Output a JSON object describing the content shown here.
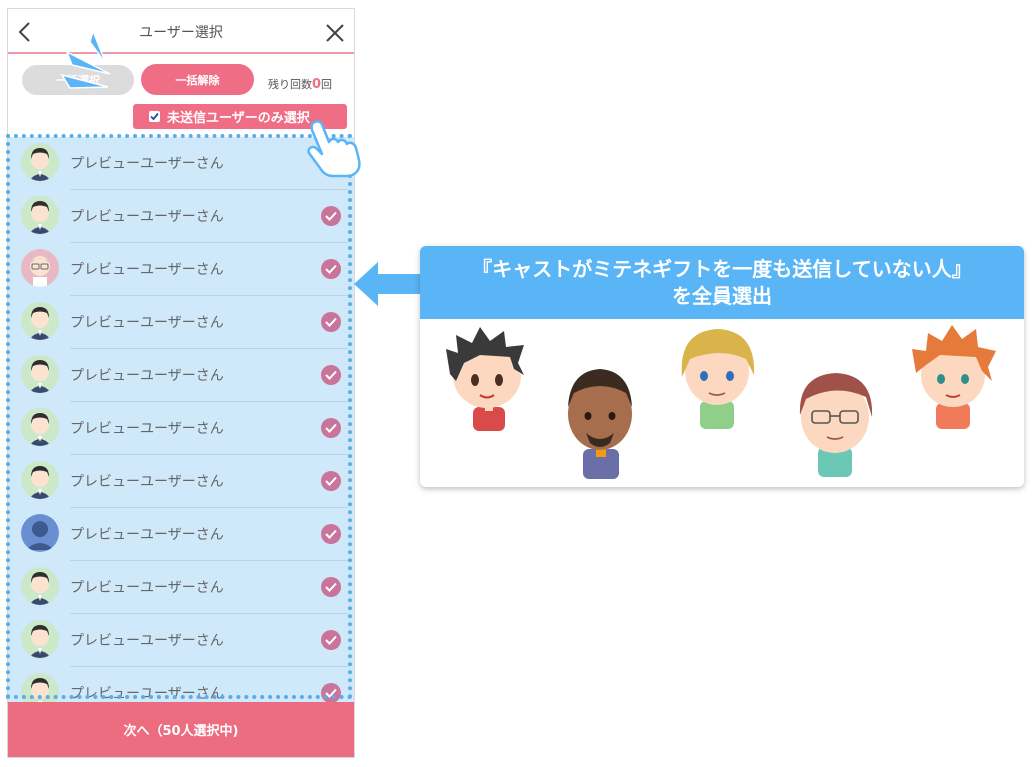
{
  "header": {
    "title": "ユーザー選択",
    "back_icon": "chevron-left-icon",
    "close_icon": "close-icon"
  },
  "toolbar": {
    "select_all_label": "一括選択",
    "deselect_all_label": "一括解除",
    "remaining_prefix": "残り回数",
    "remaining_count": "0",
    "remaining_suffix": "回",
    "unsent_only_label": "未送信ユーザーのみ選択",
    "unsent_only_checked": true
  },
  "users": [
    {
      "name": "プレビューユーザーさん",
      "avatar": "avatar-dark-hair",
      "selected": false
    },
    {
      "name": "プレビューユーザーさん",
      "avatar": "avatar-dark-hair",
      "selected": true
    },
    {
      "name": "プレビューユーザーさん",
      "avatar": "avatar-glasses",
      "selected": true
    },
    {
      "name": "プレビューユーザーさん",
      "avatar": "avatar-dark-hair",
      "selected": true
    },
    {
      "name": "プレビューユーザーさん",
      "avatar": "avatar-dark-hair",
      "selected": true
    },
    {
      "name": "プレビューユーザーさん",
      "avatar": "avatar-dark-hair",
      "selected": true
    },
    {
      "name": "プレビューユーザーさん",
      "avatar": "avatar-dark-hair",
      "selected": true
    },
    {
      "name": "プレビューユーザーさん",
      "avatar": "avatar-silhouette",
      "selected": true
    },
    {
      "name": "プレビューユーザーさん",
      "avatar": "avatar-dark-hair",
      "selected": true
    },
    {
      "name": "プレビューユーザーさん",
      "avatar": "avatar-dark-hair",
      "selected": true
    },
    {
      "name": "プレビューユーザーさん",
      "avatar": "avatar-dark-hair",
      "selected": true
    }
  ],
  "next_button_label": "次へ（50人選択中)",
  "callout": {
    "line1": "『キャストがミテネギフトを一度も送信していない人』",
    "line2": "を全員選出"
  },
  "colors": {
    "accent": "#ef6e85",
    "list_bg": "#cfe8fa",
    "check": "#c9749a",
    "callout_blue": "#5ab5f6"
  }
}
